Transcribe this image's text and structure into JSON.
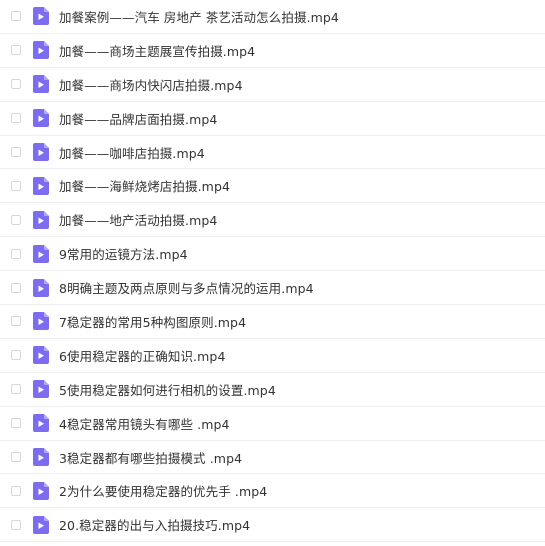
{
  "file_list": {
    "icon": "video-file-icon",
    "icon_color": "#7b6cf0",
    "items": [
      {
        "name": "加餐案例——汽车 房地产 茶艺活动怎么拍摄.mp4"
      },
      {
        "name": "加餐——商场主题展宣传拍摄.mp4"
      },
      {
        "name": "加餐——商场内快闪店拍摄.mp4"
      },
      {
        "name": "加餐——品牌店面拍摄.mp4"
      },
      {
        "name": "加餐——咖啡店拍摄.mp4"
      },
      {
        "name": "加餐——海鲜烧烤店拍摄.mp4"
      },
      {
        "name": "加餐——地产活动拍摄.mp4"
      },
      {
        "name": "9常用的运镜方法.mp4"
      },
      {
        "name": "8明确主题及两点原则与多点情况的运用.mp4"
      },
      {
        "name": "7稳定器的常用5种构图原则.mp4"
      },
      {
        "name": "6使用稳定器的正确知识.mp4"
      },
      {
        "name": "5使用稳定器如何进行相机的设置.mp4"
      },
      {
        "name": "4稳定器常用镜头有哪些 .mp4"
      },
      {
        "name": "3稳定器都有哪些拍摄模式 .mp4"
      },
      {
        "name": "2为什么要使用稳定器的优先手 .mp4"
      },
      {
        "name": "20.稳定器的出与入拍摄技巧.mp4"
      }
    ]
  }
}
